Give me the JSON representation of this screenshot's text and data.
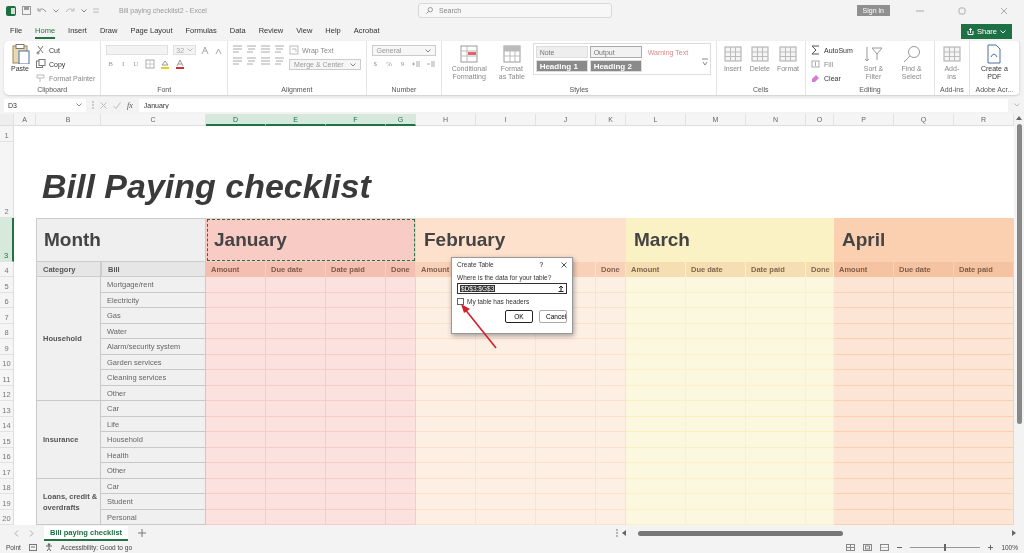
{
  "titlebar": {
    "title": "Bill paying checklist2 - Excel",
    "search": {
      "placeholder": "Search"
    },
    "sign_in": "Sign in"
  },
  "menu_tabs": [
    {
      "label": "File",
      "selected": false
    },
    {
      "label": "Home",
      "selected": true
    },
    {
      "label": "Insert",
      "selected": false
    },
    {
      "label": "Draw",
      "selected": false
    },
    {
      "label": "Page Layout",
      "selected": false
    },
    {
      "label": "Formulas",
      "selected": false
    },
    {
      "label": "Data",
      "selected": false
    },
    {
      "label": "Review",
      "selected": false
    },
    {
      "label": "View",
      "selected": false
    },
    {
      "label": "Help",
      "selected": false
    },
    {
      "label": "Acrobat",
      "selected": false
    }
  ],
  "share": "Share",
  "ribbon": [
    {
      "label": "Clipboard",
      "columns": [
        {
          "kind": "large",
          "label": "Paste"
        },
        {
          "kind": "stack",
          "items": [
            {
              "kind": "command",
              "label": "Cut"
            },
            {
              "kind": "command",
              "label": "Copy"
            },
            {
              "kind": "command",
              "label": "Format Painter"
            }
          ]
        }
      ]
    },
    {
      "label": "Font",
      "columns": [
        {
          "kind": "stack",
          "items": [
            {
              "kind": "font-row",
              "size": "32"
            },
            {
              "kind": "glyphs",
              "labels": [
                "B",
                "I",
                "U"
              ]
            }
          ]
        }
      ]
    },
    {
      "label": "Alignment",
      "columns": [
        {
          "kind": "stack",
          "items": [
            {
              "kind": "align-row"
            },
            {
              "kind": "align-row"
            }
          ]
        },
        {
          "kind": "stack",
          "items": [
            {
              "kind": "command",
              "label": "Wrap Text"
            },
            {
              "kind": "dropdown",
              "label": "Merge & Center"
            }
          ]
        }
      ]
    },
    {
      "label": "Number",
      "columns": [
        {
          "kind": "stack",
          "items": [
            {
              "kind": "dropdown",
              "label": "General"
            },
            {
              "kind": "glyphs",
              "labels": [
                "$",
                "%",
                "9"
              ]
            }
          ]
        }
      ]
    },
    {
      "label": "Styles",
      "columns": [
        {
          "kind": "large",
          "label": "Conditional Formatting"
        },
        {
          "kind": "large",
          "label": "Format as Table"
        },
        {
          "kind": "gallery",
          "styles": [
            {
              "label": "Note",
              "kind": "note"
            },
            {
              "label": "Output",
              "kind": "output"
            },
            {
              "label": "Warning Text",
              "kind": "warning"
            },
            {
              "label": "Heading 1",
              "kind": "heading"
            },
            {
              "label": "Heading 2",
              "kind": "heading"
            }
          ]
        }
      ]
    },
    {
      "label": "Cells",
      "columns": [
        {
          "kind": "large",
          "label": "Insert"
        },
        {
          "kind": "large",
          "label": "Delete"
        },
        {
          "kind": "large",
          "label": "Format"
        }
      ]
    },
    {
      "label": "Editing",
      "columns": [
        {
          "kind": "stack",
          "items": [
            {
              "kind": "command",
              "label": "AutoSum"
            },
            {
              "kind": "command",
              "label": "Fill"
            },
            {
              "kind": "command",
              "label": "Clear"
            }
          ]
        },
        {
          "kind": "large",
          "label": "Sort & Filter"
        },
        {
          "kind": "large",
          "label": "Find & Select"
        }
      ]
    },
    {
      "label": "Add-ins",
      "columns": [
        {
          "kind": "large",
          "label": "Add-ins"
        }
      ]
    },
    {
      "label": "Adobe Acr...",
      "columns": [
        {
          "kind": "large",
          "label": "Create a PDF"
        }
      ]
    }
  ],
  "formula_bar": {
    "name_box": "D3",
    "function_label": "fx",
    "value": "January"
  },
  "sheet": {
    "column_headers": [
      {
        "label": "A",
        "selected": false
      },
      {
        "label": "B",
        "selected": false
      },
      {
        "label": "C",
        "selected": false
      },
      {
        "label": "D",
        "selected": true
      },
      {
        "label": "E",
        "selected": true
      },
      {
        "label": "F",
        "selected": true
      },
      {
        "label": "G",
        "selected": true
      },
      {
        "label": "H",
        "selected": false
      },
      {
        "label": "I",
        "selected": false
      },
      {
        "label": "J",
        "selected": false
      },
      {
        "label": "K",
        "selected": false
      },
      {
        "label": "L",
        "selected": false
      },
      {
        "label": "M",
        "selected": false
      },
      {
        "label": "N",
        "selected": false
      },
      {
        "label": "O",
        "selected": false
      },
      {
        "label": "P",
        "selected": false
      },
      {
        "label": "Q",
        "selected": false
      },
      {
        "label": "R",
        "selected": false
      }
    ],
    "row_numbers": [
      {
        "label": "1",
        "selected": false
      },
      {
        "label": "2",
        "selected": false
      },
      {
        "label": "3",
        "selected": true
      },
      {
        "label": "4",
        "selected": false
      },
      {
        "label": "5",
        "selected": false
      },
      {
        "label": "6",
        "selected": false
      },
      {
        "label": "7",
        "selected": false
      },
      {
        "label": "8",
        "selected": false
      },
      {
        "label": "9",
        "selected": false
      },
      {
        "label": "10",
        "selected": false
      },
      {
        "label": "11",
        "selected": false
      },
      {
        "label": "12",
        "selected": false
      },
      {
        "label": "13",
        "selected": false
      },
      {
        "label": "14",
        "selected": false
      },
      {
        "label": "15",
        "selected": false
      },
      {
        "label": "16",
        "selected": false
      },
      {
        "label": "17",
        "selected": false
      },
      {
        "label": "18",
        "selected": false
      },
      {
        "label": "19",
        "selected": false
      },
      {
        "label": "20",
        "selected": false
      }
    ],
    "title": "Bill Paying checklist",
    "month_heading": "Month",
    "category_heading": "Category",
    "bill_heading": "Bill",
    "months": [
      {
        "name": "January",
        "color": "#f8cbc4",
        "selected": true,
        "columns": [
          "Amount",
          "Due date",
          "Date paid",
          "Done"
        ]
      },
      {
        "name": "February",
        "color": "#fde1cd",
        "selected": false,
        "columns": [
          "Amount",
          null,
          null,
          "Done"
        ]
      },
      {
        "name": "March",
        "color": "#faf1c4",
        "selected": false,
        "columns": [
          "Amount",
          "Due date",
          "Date paid",
          "Done"
        ]
      },
      {
        "name": "April",
        "color": "#fad0b0",
        "selected": false,
        "columns": [
          "Amount",
          "Due date",
          "Date paid"
        ]
      }
    ],
    "categories": [
      {
        "name": "Household",
        "bills": [
          "Mortgage/rent",
          "Electricity",
          "Gas",
          "Water",
          "Alarm/security system",
          "Garden services",
          "Cleaning services",
          "Other"
        ]
      },
      {
        "name": "Insurance",
        "bills": [
          "Car",
          "Life",
          "Household",
          "Health",
          "Other"
        ]
      },
      {
        "name": "Loans, credit & overdrafts",
        "bills": [
          "Car",
          "Student",
          "Personal"
        ]
      }
    ]
  },
  "dialog": {
    "title": "Create Table",
    "help": "?",
    "prompt": "Where is the data for your table?",
    "range": "$D$3:$G$3",
    "checkbox": {
      "label": "My table has headers",
      "checked": false
    },
    "buttons": [
      "OK",
      "Cancel"
    ]
  },
  "sheet_tabs": [
    {
      "label": "Bill paying checklist",
      "selected": true
    }
  ],
  "status_bar": {
    "mode": "Point",
    "accessibility": "Accessibility: Good to go",
    "zoom": "100%",
    "zoom_level": {
      "level": 0.5
    }
  }
}
